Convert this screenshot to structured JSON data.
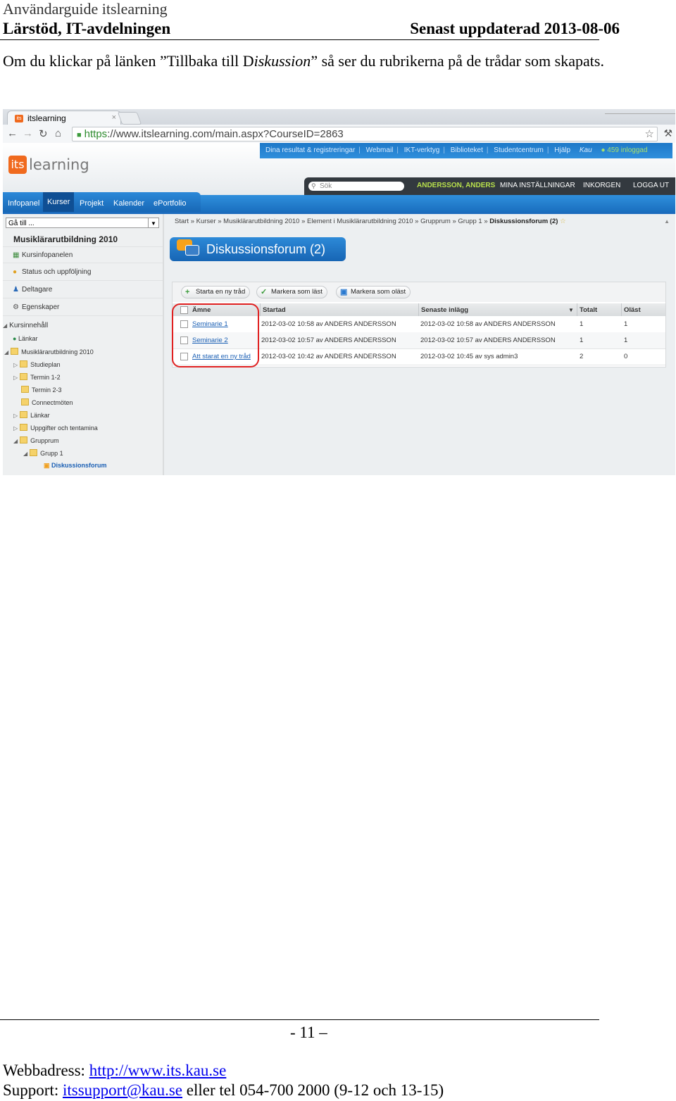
{
  "document": {
    "title": "Användarguide itslearning",
    "department": "Lärstöd, IT-avdelningen",
    "updated": "Senast uppdaterad 2013-08-06",
    "intro_before": "Om du klickar på länken  ”Tillbaka till D",
    "intro_italic": "iskussion",
    "intro_after": "” så ser du rubrikerna på de trådar som skapats.",
    "page_number": "- 11 –",
    "footer_web_label": "Webbadress: ",
    "footer_web_link": "http://www.its.kau.se",
    "footer_support_label": "Support: ",
    "footer_support_link": "itssupport@kau.se",
    "footer_support_rest": " eller tel 054-700 2000 (9-12 och 13-15)"
  },
  "browser": {
    "tab_title": "itslearning",
    "tab_close": "×",
    "url_https": "https",
    "url_rest": "://www.itslearning.com/main.aspx?CourseID=2863"
  },
  "site": {
    "logo_box": "its",
    "logo_word": "learning",
    "top_links": [
      "Dina resultat & registreringar",
      "Webmail",
      "IKT-verktyg",
      "Biblioteket",
      "Studentcentrum",
      "Hjälp"
    ],
    "top_kau": "Kau",
    "top_online": "459 inloggad",
    "search_placeholder": "Sök",
    "user_name": "ANDERSSON, ANDERS",
    "user_links": [
      "MINA INSTÄLLNINGAR",
      "INKORGEN",
      "LOGGA UT"
    ],
    "nav": [
      "Infopanel",
      "Kurser",
      "Projekt",
      "Kalender",
      "ePortfolio"
    ]
  },
  "sidebar": {
    "goto": "Gå till ...",
    "course_title": "Musiklärarutbildning 2010",
    "items": [
      "Kursinfopanelen",
      "Status och uppföljning",
      "Deltagare",
      "Egenskaper"
    ],
    "content_header": "Kursinnehåll",
    "tree": [
      "Länkar",
      "Musiklärarutbildning 2010",
      "Studieplan",
      "Termin 1-2",
      "Termin 2-3",
      "Connectmöten",
      "Länkar",
      "Uppgifter och tentamina",
      "Grupprum",
      "Grupp 1",
      "Diskussionsforum"
    ]
  },
  "main": {
    "breadcrumbs": [
      "Start",
      "Kurser",
      "Musiklärarutbildning 2010",
      "Element i Musiklärarutbildning 2010",
      "Grupprum",
      "Grupp 1"
    ],
    "breadcrumb_current": "Diskussionsforum (2)",
    "forum_title": "Diskussionsforum (2)",
    "toolbar": [
      "Starta en ny tråd",
      "Markera som läst",
      "Markera som oläst"
    ],
    "columns": [
      "Ämne",
      "Startad",
      "Senaste inlägg",
      "Totalt",
      "Oläst"
    ],
    "rows": [
      {
        "subject": "Seminarie 1",
        "started": "2012-03-02 10:58 av ANDERS ANDERSSON",
        "latest": "2012-03-02 10:58 av ANDERS ANDERSSON",
        "total": "1",
        "unread": "1"
      },
      {
        "subject": "Seminarie 2",
        "started": "2012-03-02 10:57 av ANDERS ANDERSSON",
        "latest": "2012-03-02 10:57 av ANDERS ANDERSSON",
        "total": "1",
        "unread": "1"
      },
      {
        "subject": "Att starat en ny tråd",
        "started": "2012-03-02 10:42 av ANDERS ANDERSSON",
        "latest": "2012-03-02 10:45 av sys admin3",
        "total": "2",
        "unread": "0"
      }
    ]
  }
}
